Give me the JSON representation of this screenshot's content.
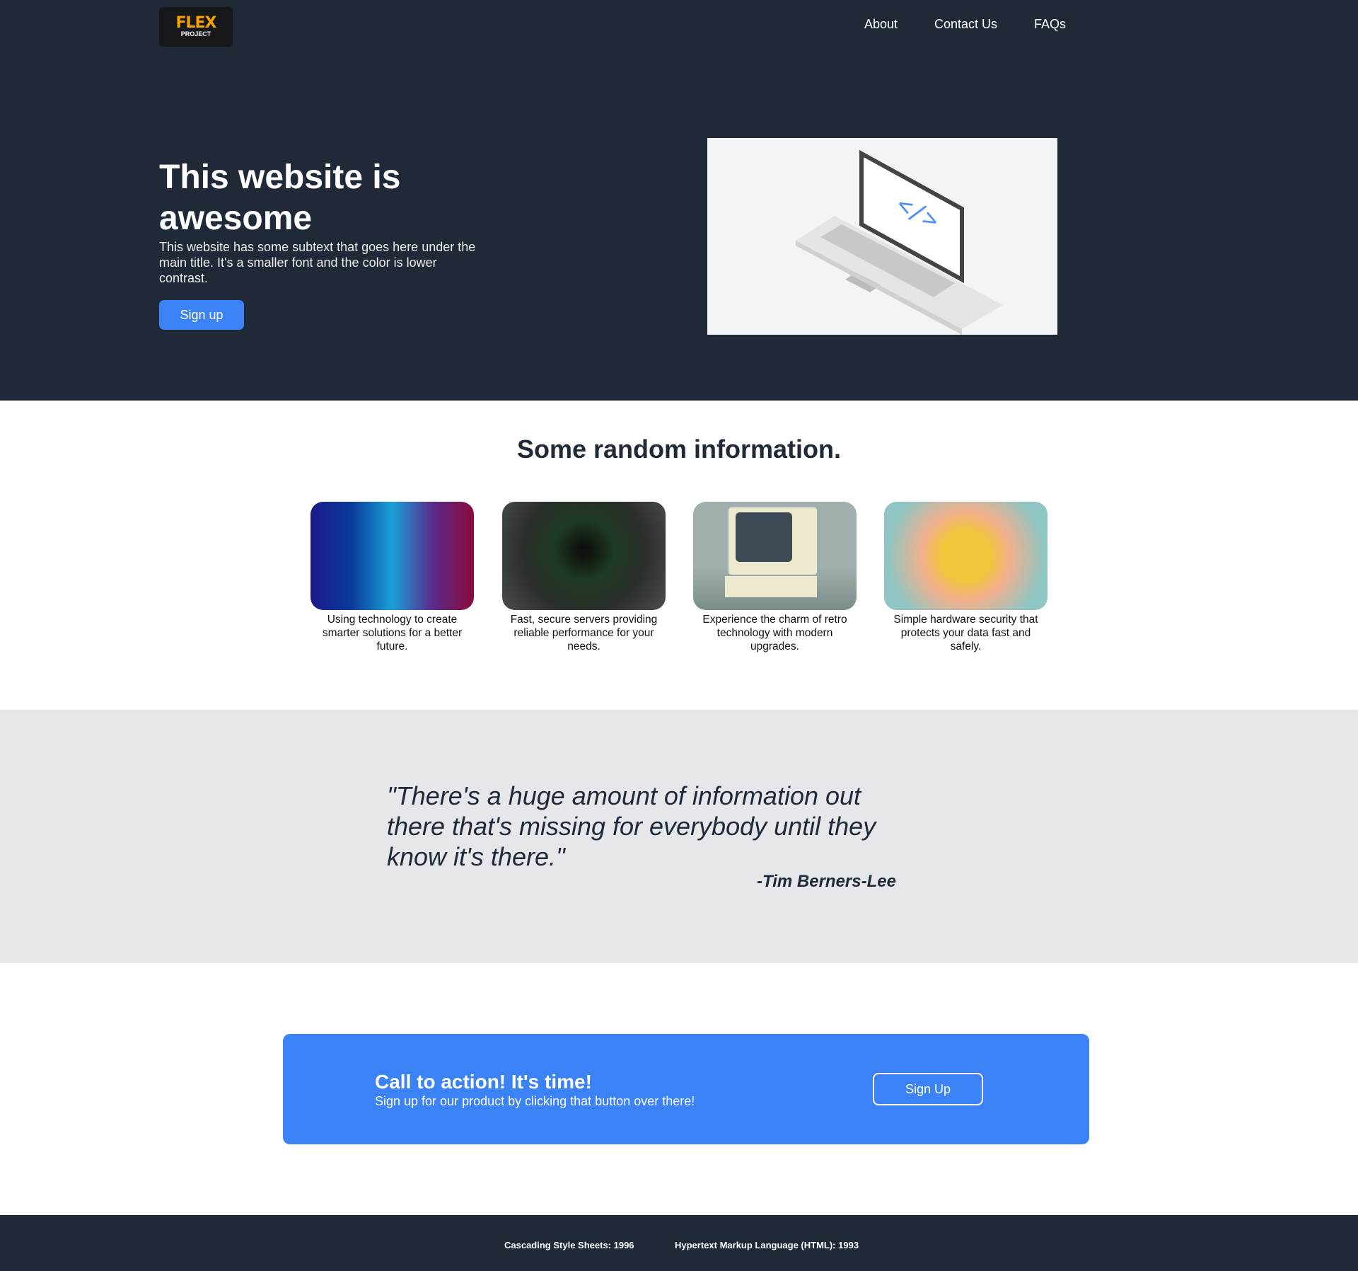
{
  "logo": {
    "name": "FLEX",
    "sub": "PROJECT"
  },
  "nav": [
    "About",
    "Contact Us",
    "FAQs"
  ],
  "hero": {
    "title": "This website is awesome",
    "subtext": "This website has some subtext that goes here under the main title. It's a smaller font and the color is lower contrast.",
    "button": "Sign up"
  },
  "info": {
    "title": "Some random information.",
    "cards": [
      {
        "caption": "Using technology to create smarter solutions for a better future."
      },
      {
        "caption": "Fast, secure servers providing reliable performance for your needs."
      },
      {
        "caption": "Experience the charm of retro technology with modern upgrades."
      },
      {
        "caption": "Simple hardware security that protects your data fast and safely."
      }
    ]
  },
  "quote": {
    "text": "\"There's a huge amount of information out there that's missing for everybody until they know it's there.\"",
    "author": "-Tim Berners-Lee"
  },
  "cta": {
    "title": "Call to action! It's time!",
    "subtitle": "Sign up for our product by clicking that button over there!",
    "button": "Sign Up"
  },
  "footer": [
    "Cascading Style Sheets: 1996",
    "Hypertext Markup Language (HTML): 1993"
  ],
  "colors": {
    "dark": "#1f2937",
    "accent": "#3b82f6",
    "gray": "#e5e7eb"
  }
}
